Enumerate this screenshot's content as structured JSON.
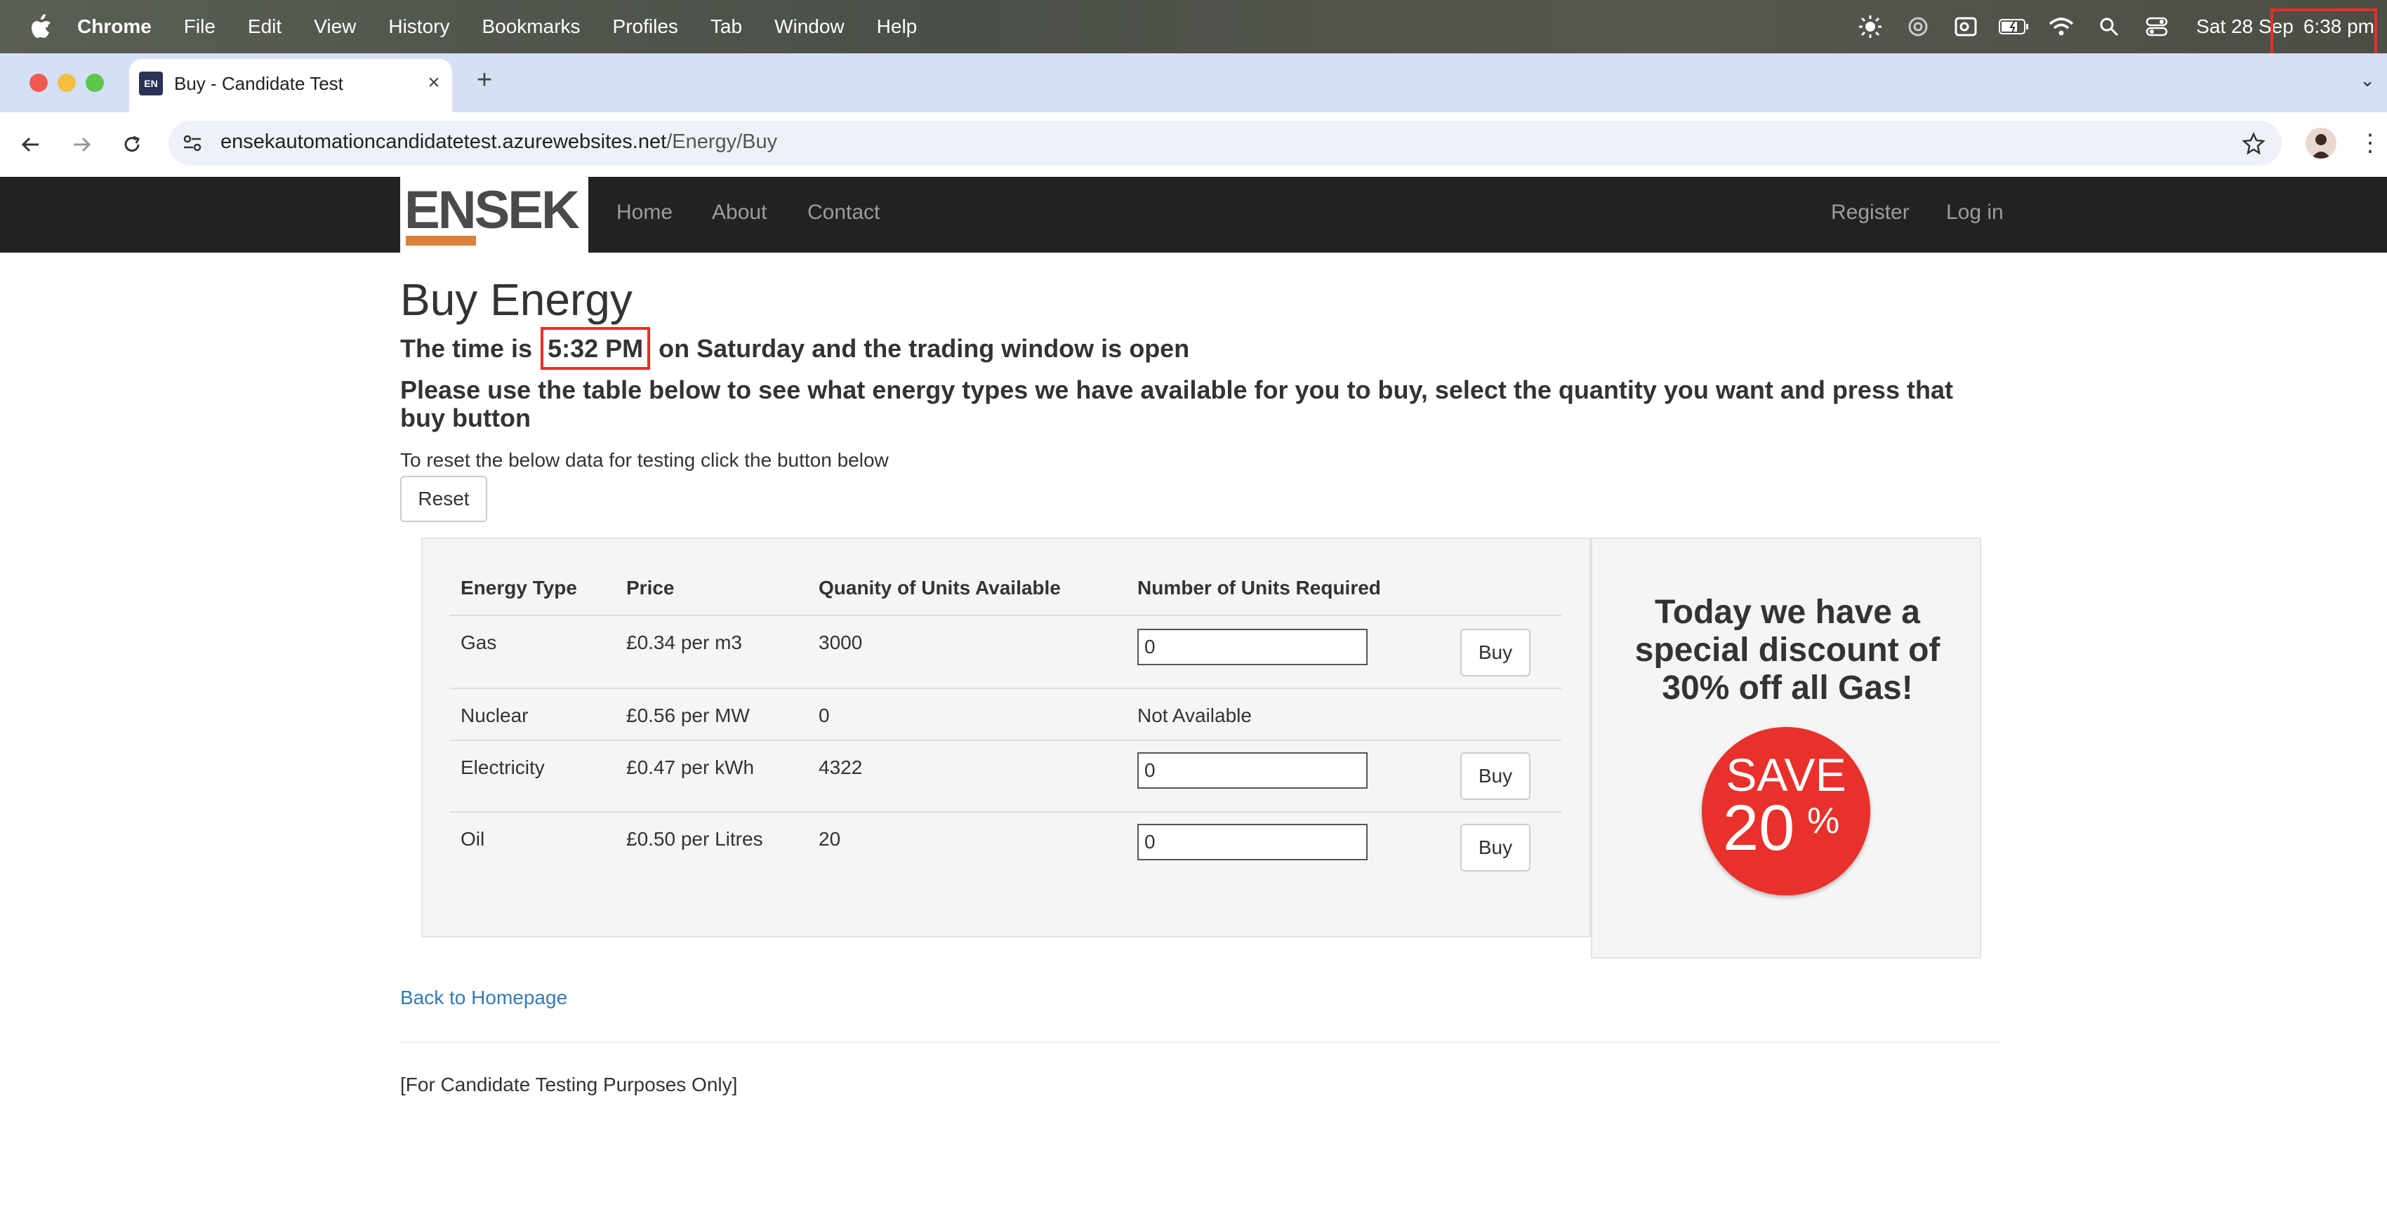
{
  "menubar": {
    "items": [
      "Chrome",
      "File",
      "Edit",
      "View",
      "History",
      "Bookmarks",
      "Profiles",
      "Tab",
      "Window",
      "Help"
    ],
    "date": "Sat 28 Sep",
    "time": "6:38 pm"
  },
  "browser": {
    "tab_title": "Buy - Candidate Test",
    "favicon_text": "EN",
    "url_host": "ensekautomationcandidatetest.azurewebsites.net",
    "url_path": "/Energy/Buy"
  },
  "site": {
    "logo": "ENSEK",
    "nav_left": [
      "Home",
      "About",
      "Contact"
    ],
    "nav_right": [
      "Register",
      "Log in"
    ]
  },
  "page": {
    "title": "Buy Energy",
    "time_prefix": "The time is",
    "time_value": "5:32 PM",
    "time_suffix": "on Saturday and the trading window is open",
    "instructions": "Please use the table below to see what energy types we have available for you to buy, select the quantity you want and press that buy button",
    "reset_text": "To reset the below data for testing click the button below",
    "reset_label": "Reset"
  },
  "table": {
    "headers": [
      "Energy Type",
      "Price",
      "Quanity of Units Available",
      "Number of Units Required"
    ],
    "rows": [
      {
        "type": "Gas",
        "price": "£0.34 per m3",
        "available": "3000",
        "required": "0",
        "buy": "Buy"
      },
      {
        "type": "Nuclear",
        "price": "£0.56 per MW",
        "available": "0",
        "status": "Not Available"
      },
      {
        "type": "Electricity",
        "price": "£0.47 per kWh",
        "available": "4322",
        "required": "0",
        "buy": "Buy"
      },
      {
        "type": "Oil",
        "price": "£0.50 per Litres",
        "available": "20",
        "required": "0",
        "buy": "Buy"
      }
    ]
  },
  "promo": {
    "text": "Today we have a special discount of 30% off all Gas!",
    "badge_word": "SAVE",
    "badge_number": "20",
    "badge_percent": "%"
  },
  "footer": {
    "back_link": "Back to Homepage",
    "note": "[For Candidate Testing Purposes Only]"
  },
  "colors": {
    "highlight": "#e5302a",
    "navbar": "#222222",
    "link": "#337ab7",
    "logo_accent": "#d9813b"
  }
}
